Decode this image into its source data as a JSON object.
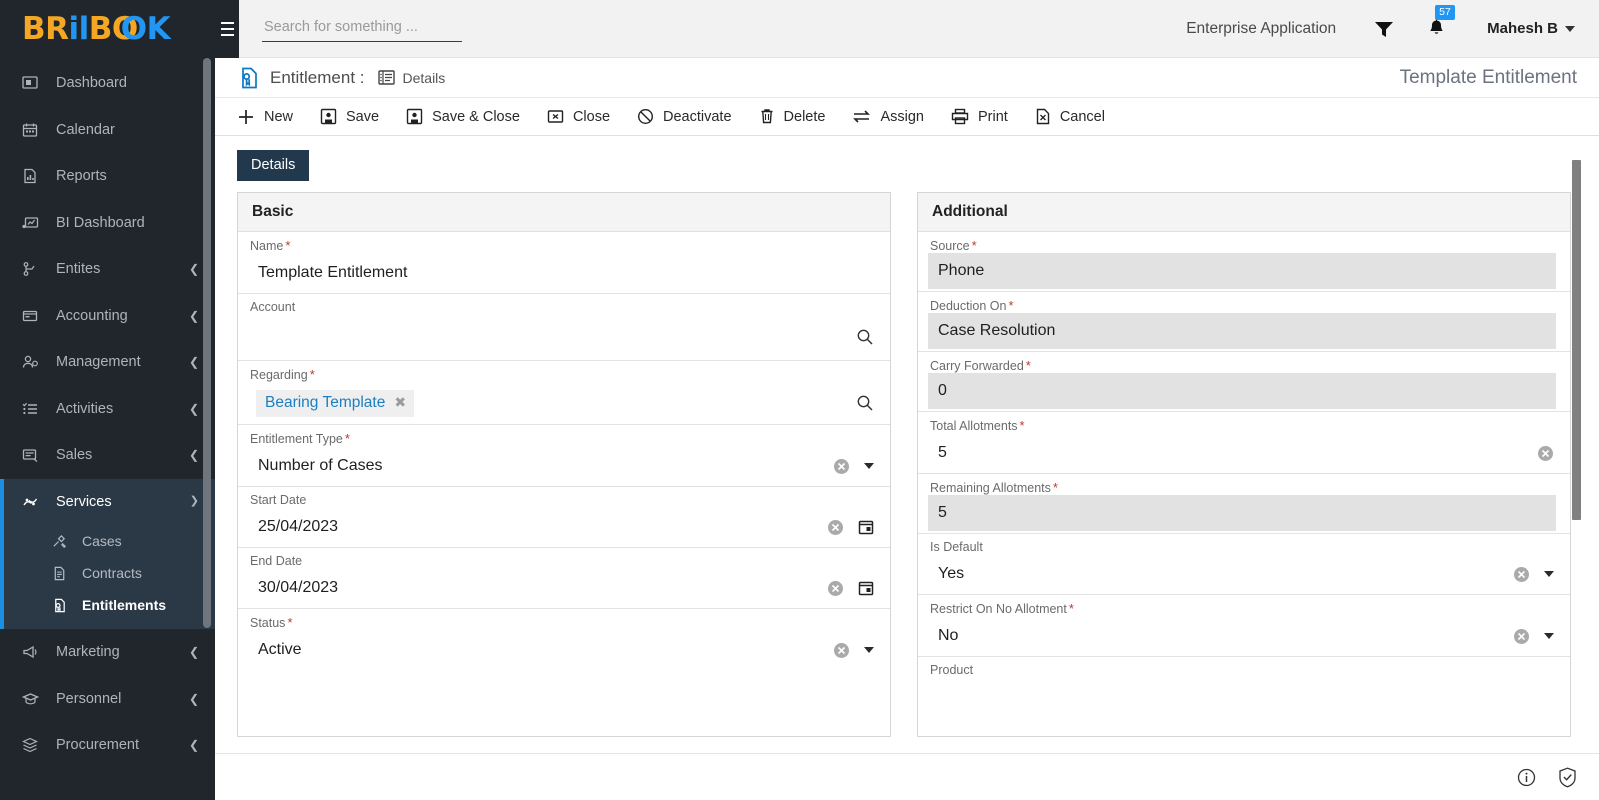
{
  "brand": {
    "logo_part1": "BR",
    "logo_part2": "il",
    "logo_part3": "B",
    "logo_part4": "O",
    "logo_part5": "K",
    "orange": "#f5a623",
    "blue": "#2196f3"
  },
  "sidebar": {
    "items": [
      {
        "label": "Dashboard",
        "icon": "dashboard-icon",
        "expandable": false
      },
      {
        "label": "Calendar",
        "icon": "calendar-icon",
        "expandable": false
      },
      {
        "label": "Reports",
        "icon": "report-icon",
        "expandable": false
      },
      {
        "label": "BI Dashboard",
        "icon": "bi-dashboard-icon",
        "expandable": false
      },
      {
        "label": "Entites",
        "icon": "entities-icon",
        "expandable": true
      },
      {
        "label": "Accounting",
        "icon": "accounting-icon",
        "expandable": true
      },
      {
        "label": "Management",
        "icon": "management-icon",
        "expandable": true
      },
      {
        "label": "Activities",
        "icon": "activities-icon",
        "expandable": true
      },
      {
        "label": "Sales",
        "icon": "sales-icon",
        "expandable": true
      }
    ],
    "services": {
      "label": "Services",
      "icon": "services-icon",
      "expanded": true,
      "children": [
        {
          "label": "Cases",
          "icon": "cases-icon",
          "active": false
        },
        {
          "label": "Contracts",
          "icon": "contracts-icon",
          "active": false
        },
        {
          "label": "Entitlements",
          "icon": "entitlements-icon",
          "active": true
        }
      ]
    },
    "items_after": [
      {
        "label": "Marketing",
        "icon": "marketing-icon",
        "expandable": true
      },
      {
        "label": "Personnel",
        "icon": "personnel-icon",
        "expandable": true
      },
      {
        "label": "Procurement",
        "icon": "procurement-icon",
        "expandable": true
      }
    ]
  },
  "topbar": {
    "search_placeholder": "Search for something ...",
    "app_name": "Enterprise Application",
    "notification_count": "57",
    "user_name": "Mahesh B"
  },
  "record_header": {
    "entity_label": "Entitlement :",
    "view_label": "Details",
    "record_name": "Template Entitlement"
  },
  "toolbar": {
    "buttons": [
      {
        "label": "New",
        "icon": "plus-icon"
      },
      {
        "label": "Save",
        "icon": "save-icon"
      },
      {
        "label": "Save & Close",
        "icon": "save-close-icon"
      },
      {
        "label": "Close",
        "icon": "close-box-icon"
      },
      {
        "label": "Deactivate",
        "icon": "deactivate-icon"
      },
      {
        "label": "Delete",
        "icon": "trash-icon"
      },
      {
        "label": "Assign",
        "icon": "assign-icon"
      },
      {
        "label": "Print",
        "icon": "print-icon"
      },
      {
        "label": "Cancel",
        "icon": "cancel-file-icon"
      }
    ]
  },
  "tabs": [
    {
      "label": "Details",
      "active": true
    }
  ],
  "basic_panel": {
    "title": "Basic",
    "fields": [
      {
        "label": "Name",
        "required": true,
        "value": "Template Entitlement",
        "type": "text",
        "readonly": false
      },
      {
        "label": "Account",
        "required": false,
        "value": "",
        "type": "lookup",
        "readonly": false
      },
      {
        "label": "Regarding",
        "required": true,
        "value": "Bearing Template",
        "type": "chip-lookup",
        "readonly": false
      },
      {
        "label": "Entitlement Type",
        "required": true,
        "value": "Number of Cases",
        "type": "select",
        "readonly": false
      },
      {
        "label": "Start Date",
        "required": false,
        "value": "25/04/2023",
        "type": "date",
        "readonly": false
      },
      {
        "label": "End Date",
        "required": false,
        "value": "30/04/2023",
        "type": "date",
        "readonly": false
      },
      {
        "label": "Status",
        "required": true,
        "value": "Active",
        "type": "select",
        "readonly": false
      }
    ]
  },
  "additional_panel": {
    "title": "Additional",
    "fields": [
      {
        "label": "Source",
        "required": true,
        "value": "Phone",
        "type": "text",
        "readonly": true
      },
      {
        "label": "Deduction On",
        "required": true,
        "value": "Case Resolution",
        "type": "text",
        "readonly": true
      },
      {
        "label": "Carry Forwarded",
        "required": true,
        "value": "0",
        "type": "text",
        "readonly": true
      },
      {
        "label": "Total Allotments",
        "required": true,
        "value": "5",
        "type": "number",
        "readonly": false
      },
      {
        "label": "Remaining Allotments",
        "required": true,
        "value": "5",
        "type": "number",
        "readonly": true
      },
      {
        "label": "Is Default",
        "required": false,
        "value": "Yes",
        "type": "select",
        "readonly": false
      },
      {
        "label": "Restrict On No Allotment",
        "required": true,
        "value": "No",
        "type": "select",
        "readonly": false
      },
      {
        "label": "Product",
        "required": false,
        "value": "",
        "type": "lookup",
        "readonly": false
      }
    ]
  },
  "statusbar": {
    "info_icon": "info-icon",
    "shield_icon": "shield-check-icon"
  }
}
